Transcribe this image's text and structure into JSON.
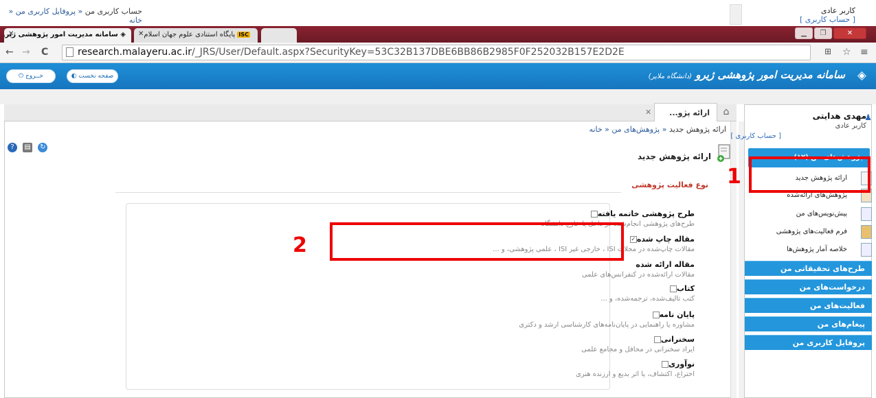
{
  "top_breadcrumb": {
    "items": [
      "خانه",
      "پروفایل کاربری من"
    ],
    "current": "حساب کاربری من"
  },
  "top_user": {
    "role": "کاربر عادی",
    "account_link": "[ حساب کاربری ]"
  },
  "browser": {
    "tabs": [
      {
        "label": "سامانه مدیریت امور پژوهشی ژیرو"
      },
      {
        "label": "پایگاه استنادی علوم جهان اسلام",
        "badge": "ISC"
      }
    ],
    "url_host": "research.malayeru.ac.ir",
    "url_path": "/_JRS/User/Default.aspx?SecurityKey=53C32B137DBE6BB86B2985F0F252032B157E2D2E"
  },
  "app": {
    "title": "سامانه مدیریت امور پژوهشی ژیرو",
    "university": "(دانشگاه ملایر)",
    "home_button": "صفحه نخست",
    "exit_button": "خــروج"
  },
  "panel": {
    "tab_label": "ارائه پژو...",
    "breadcrumb": {
      "items": [
        "خانه",
        "پژوهش‌های من"
      ],
      "current": "ارائه پژوهش جدید"
    },
    "page_title": "ارائه پژوهش جدید",
    "section_title": "نوع فعالیت پژوهشی",
    "options": [
      {
        "label": "طرح پژوهشی خاتمه یافته",
        "desc": "طرح‌های پژوهشی انجام‌شده در داخل یا خارج دانشگاه",
        "checked": false
      },
      {
        "label": "مقاله چاپ شده",
        "desc": "مقالات چاپ‌شده در مجلات ISI ، خارجی غیر ISI ، علمی پژوهشی، و ...",
        "checked": true
      },
      {
        "label": "مقاله ارائه شده",
        "desc": "مقالات ارائه‌شده در کنفرانس‌های علمی",
        "checked": false
      },
      {
        "label": "کتاب",
        "desc": "کتب تالیف‌شده، ترجمه‌شده، و ...",
        "checked": false
      },
      {
        "label": "پایان نامه",
        "desc": "مشاوره یا راهنمایی در پایان‌نامه‌های کارشناسی ارشد و دکتری",
        "checked": false
      },
      {
        "label": "سخنرانی",
        "desc": "ایراد سخنرانی در محافل و مجامع علمی",
        "checked": false
      },
      {
        "label": "نوآوری",
        "desc": "اختراع، اکتشاف، یا اثر بدیع و ارزنده هنری",
        "checked": false
      }
    ]
  },
  "sidebar": {
    "user_name": "مهدی هدایتی",
    "role": "کاربر عادی",
    "account_link": "[ حساب کاربری ]",
    "section_header": "پژوهش‌های من (۱۲)",
    "items": [
      {
        "label": "ارائه پژوهش جدید"
      },
      {
        "label": "پژوهش‌های ارائه‌شده"
      },
      {
        "label": "پیش‌نویس‌های من"
      },
      {
        "label": "فرم فعالیت‌های پژوهشی"
      },
      {
        "label": "خلاصه آمار پژوهش‌ها"
      }
    ],
    "nav": [
      {
        "label": "طرح‌های تحقیقاتی من"
      },
      {
        "label": "درخواست‌های من"
      },
      {
        "label": "فعالیت‌های من"
      },
      {
        "label": "پیغام‌های من"
      },
      {
        "label": "پروفایل کاربری من"
      }
    ]
  },
  "annotations": {
    "marker1": "1",
    "marker2": "2",
    "color": "#e00000"
  }
}
